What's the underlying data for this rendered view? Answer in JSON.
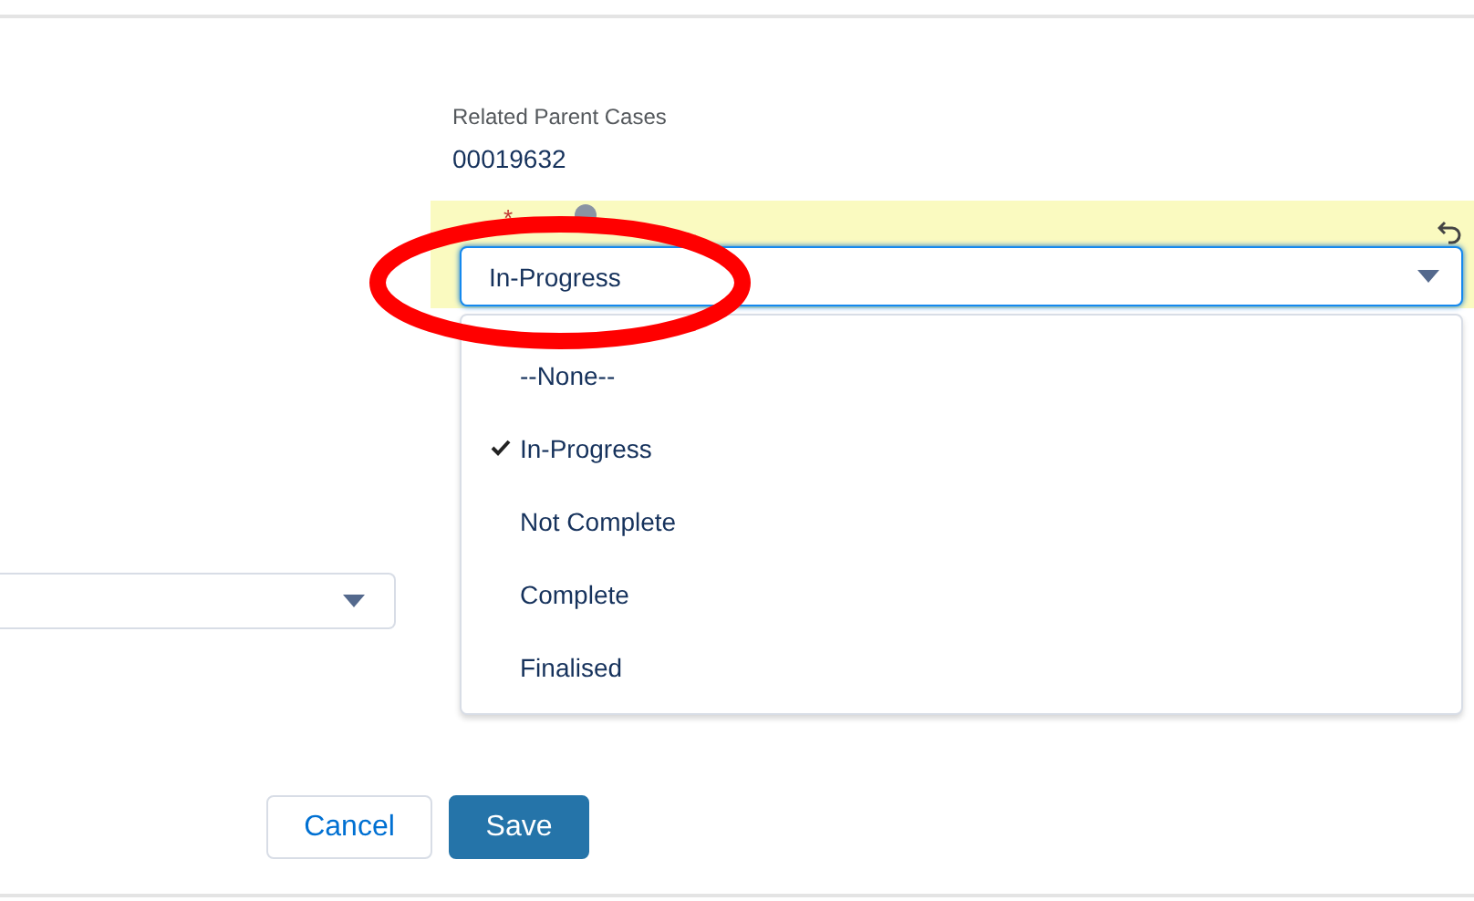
{
  "related_parent_cases": {
    "label": "Related Parent Cases",
    "value": "00019632"
  },
  "status_field": {
    "required_mark": "*",
    "value": "In-Progress",
    "open": true,
    "options": [
      {
        "label": "--None--",
        "selected": false
      },
      {
        "label": "In-Progress",
        "selected": true
      },
      {
        "label": "Not Complete",
        "selected": false
      },
      {
        "label": "Complete",
        "selected": false
      },
      {
        "label": "Finalised",
        "selected": false
      }
    ]
  },
  "buttons": [
    {
      "label": "Cancel",
      "kind": "neutral"
    },
    {
      "label": "Save",
      "kind": "brand"
    }
  ]
}
